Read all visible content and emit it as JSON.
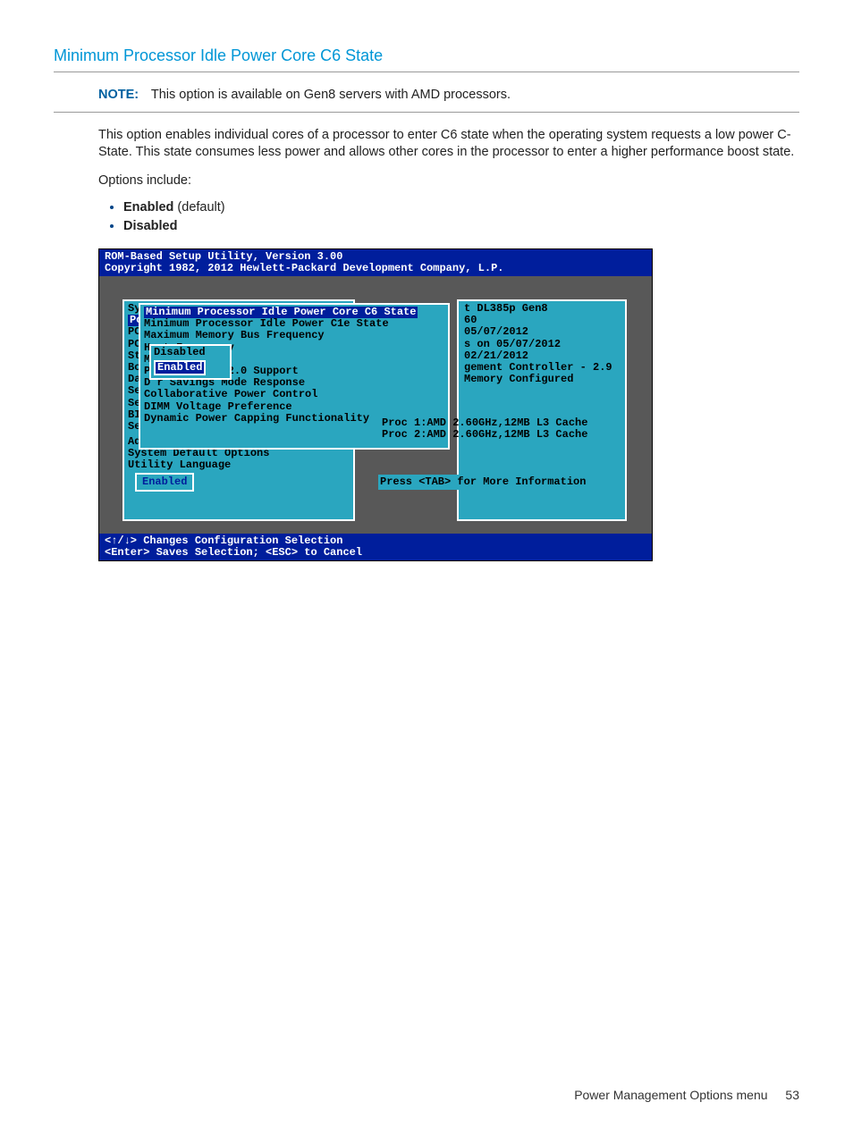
{
  "heading": "Minimum Processor Idle Power Core C6 State",
  "note": {
    "label": "NOTE:",
    "text": "This option is available on Gen8 servers with AMD processors."
  },
  "para1": "This option enables individual cores of a processor to enter C6 state when the operating system requests a low power C-State. This state consumes less power and allows other cores in the processor to enter a higher performance boost state.",
  "para2": "Options include:",
  "options": [
    {
      "bold": "Enabled",
      "suffix": " (default)"
    },
    {
      "bold": "Disabled",
      "suffix": ""
    }
  ],
  "bios": {
    "header1": "ROM-Based Setup Utility, Version 3.00",
    "header2": "Copyright 1982, 2012 Hewlett-Packard Development Company, L.P.",
    "leftItems": [
      "Sy",
      "Po",
      "PC",
      "PC",
      "St",
      "Bo",
      "Da",
      "Se",
      "Se",
      "BI",
      "Se"
    ],
    "leftItemsRow2": [
      "Advanced Options",
      "System Default Options",
      "Utility Language"
    ],
    "leftHighlightIndex": 1,
    "leftExtra": {
      "advanced": "Advanced Options",
      "sysdef": "System Default Options",
      "util": "Utility Language"
    },
    "menuItems": [
      "Minimum Processor Idle Power Core C6 State",
      "Minimum Processor Idle Power C1e State",
      "Maximum Memory Bus Frequency",
      "H           rt Frequency",
      "M           leaving",
      "P           Generation 2.0 Support",
      "D           r Savings Mode Response",
      "Collaborative Power Control",
      "DIMM Voltage Preference",
      "Dynamic Power Capping Functionality"
    ],
    "popup": {
      "opt1": "Disabled",
      "opt2": "Enabled"
    },
    "info": [
      "t DL385p Gen8",
      "60",
      "",
      "  05/07/2012",
      "s on 05/07/2012",
      "02/21/2012",
      "gement Controller - 2.9",
      "",
      "Memory Configured"
    ],
    "proc1": "Proc 1:AMD 2.60GHz,12MB L3 Cache",
    "proc2": "Proc 2:AMD 2.60GHz,12MB L3 Cache",
    "status": "Enabled",
    "tab": "Press <TAB> for More Information",
    "footer1": "<↑/↓> Changes Configuration Selection",
    "footer2": "<Enter> Saves Selection; <ESC> to Cancel"
  },
  "footer": {
    "title": "Power Management Options menu",
    "page": "53"
  }
}
